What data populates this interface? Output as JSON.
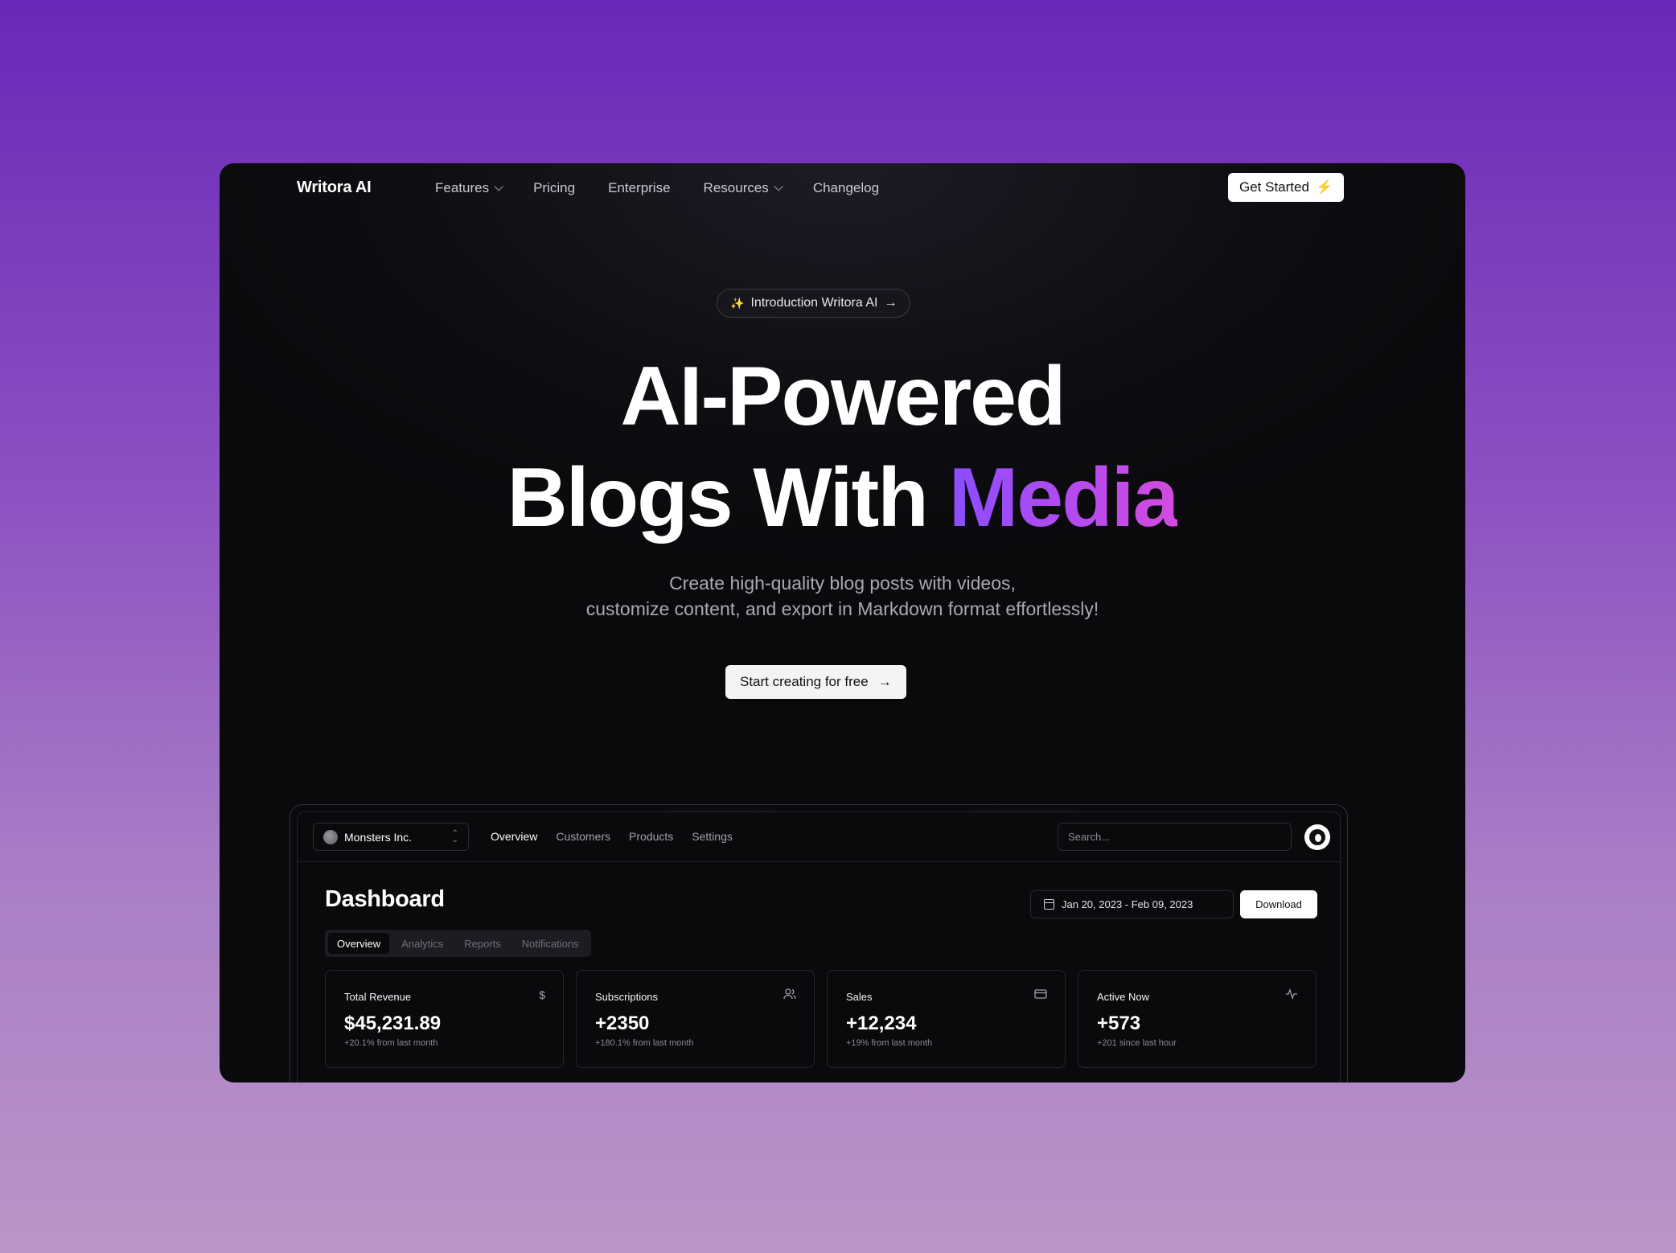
{
  "nav": {
    "brand": "Writora AI",
    "links": [
      "Features",
      "Pricing",
      "Enterprise",
      "Resources",
      "Changelog"
    ],
    "cta": "Get Started"
  },
  "hero": {
    "pill": "Introduction Writora AI",
    "title_line1": "AI-Powered",
    "title_line2_a": "Blogs With ",
    "title_line2_b": "Media",
    "subtitle_line1": "Create high-quality blog posts with videos,",
    "subtitle_line2": "customize content, and export in Markdown format effortlessly!",
    "cta": "Start creating for free",
    "accent_gradient": [
      "#8a4dff",
      "#d44be0"
    ]
  },
  "dashboard": {
    "team": "Monsters Inc.",
    "tabs": [
      "Overview",
      "Customers",
      "Products",
      "Settings"
    ],
    "search_placeholder": "Search...",
    "title": "Dashboard",
    "date_range": "Jan 20, 2023 - Feb 09, 2023",
    "download": "Download",
    "subtabs": [
      "Overview",
      "Analytics",
      "Reports",
      "Notifications"
    ],
    "cards": [
      {
        "title": "Total Revenue",
        "icon": "dollar-icon",
        "value": "$45,231.89",
        "note": "+20.1% from last month"
      },
      {
        "title": "Subscriptions",
        "icon": "users-icon",
        "value": "+2350",
        "note": "+180.1% from last month"
      },
      {
        "title": "Sales",
        "icon": "credit-card-icon",
        "value": "+12,234",
        "note": "+19% from last month"
      },
      {
        "title": "Active Now",
        "icon": "activity-icon",
        "value": "+573",
        "note": "+201 since last hour"
      }
    ]
  }
}
